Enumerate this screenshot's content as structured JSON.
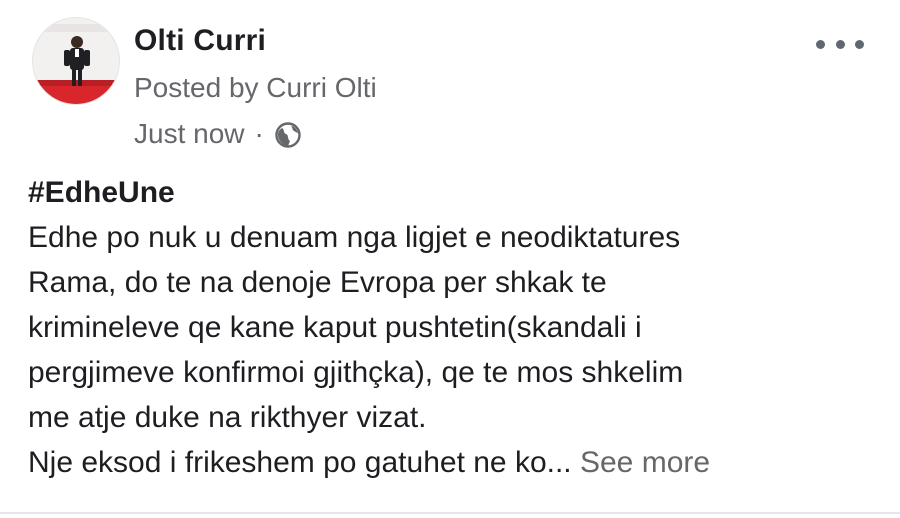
{
  "post": {
    "author_name": "Olti Curri",
    "posted_by": "Posted by Curri Olti",
    "timestamp": "Just now",
    "separator": "·",
    "privacy_icon": "globe-icon",
    "menu_icon": "more-horizontal-icon",
    "hashtag": "#EdheUne",
    "body_lines": [
      "Edhe po nuk u denuam nga ligjet e neodiktatures",
      "Rama, do te na denoje Evropa per shkak te",
      "krimineleve qe kane kaput pushtetin(skandali i",
      "pergjimeve konfirmoi gjithçka), qe te mos shkelim",
      "me atje duke na rikthyer vizat.",
      "Nje eksod i frikeshem po gatuhet ne ko..."
    ],
    "see_more": "See more"
  },
  "colors": {
    "text_primary": "#1c1e21",
    "text_secondary": "#65676b",
    "avatar_accent": "#d9262c"
  }
}
